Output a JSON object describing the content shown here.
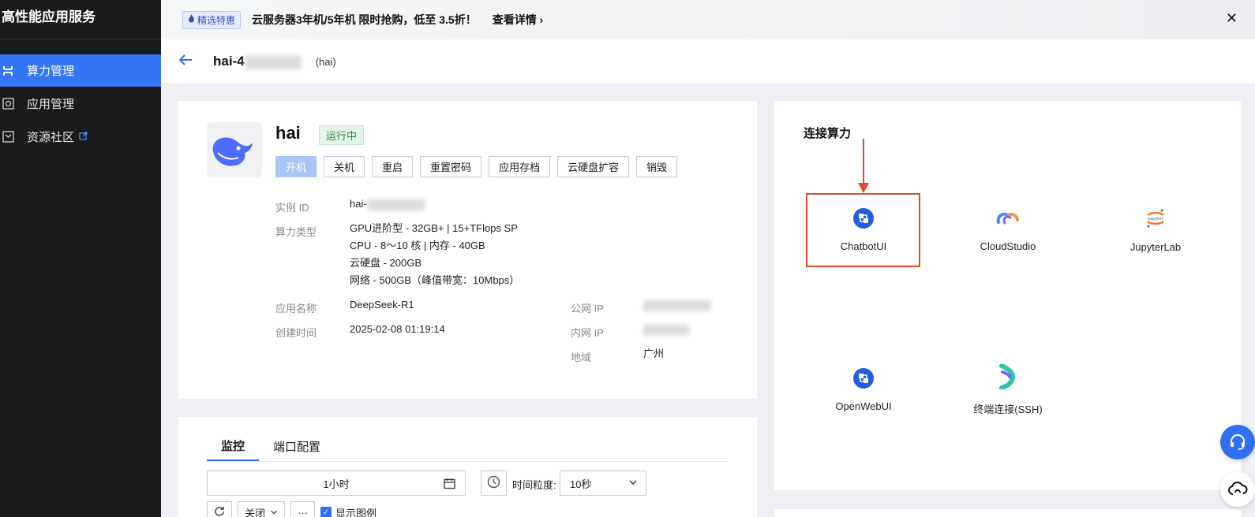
{
  "sidebar": {
    "brand": "高性能应用服务",
    "items": [
      {
        "label": "算力管理",
        "icon": "grid-icon",
        "active": true
      },
      {
        "label": "应用管理",
        "icon": "app-icon",
        "active": false
      },
      {
        "label": "资源社区",
        "icon": "community-icon",
        "active": false,
        "external": true
      }
    ]
  },
  "topbar": {
    "tag": "精选特惠",
    "text": "云服务器3年机/5年机 限时抢购，低至 3.5折！",
    "link": "查看详情"
  },
  "header": {
    "title": "hai-4",
    "subtitle": "(hai)"
  },
  "instance": {
    "name": "hai",
    "status": "运行中",
    "actions": [
      "开机",
      "关机",
      "重启",
      "重置密码",
      "应用存档",
      "云硬盘扩容",
      "销毁"
    ],
    "fields": {
      "id_label": "实例 ID",
      "id_value": "hai-",
      "type_label": "算力类型",
      "type_lines": [
        "GPU进阶型 - 32GB+ | 15+TFlops SP",
        "CPU - 8～10 核 | 内存 - 40GB",
        "云硬盘 - 200GB",
        "网络 - 500GB（峰值带宽：10Mbps）"
      ],
      "app_label": "应用名称",
      "app_value": "DeepSeek-R1",
      "created_label": "创建时间",
      "created_value": "2025-02-08 01:19:14",
      "public_ip_label": "公网 IP",
      "private_ip_label": "内网 IP",
      "region_label": "地域",
      "region_value": "广州"
    }
  },
  "connect": {
    "title": "连接算力",
    "tools": [
      "ChatbotUI",
      "CloudStudio",
      "JupyterLab",
      "OpenWebUI",
      "终端连接(SSH)"
    ]
  },
  "monitor": {
    "tabs": [
      "监控",
      "端口配置"
    ],
    "range": "1小时",
    "granularity_label": "时间粒度:",
    "granularity_value": "10秒",
    "close_label": "关闭",
    "legend_label": "显示图例"
  },
  "colors": {
    "accent": "#3576f6",
    "sidebar_bg": "#1b1b1d",
    "highlight": "#e04a2f",
    "status_green": "#2a8a45"
  }
}
